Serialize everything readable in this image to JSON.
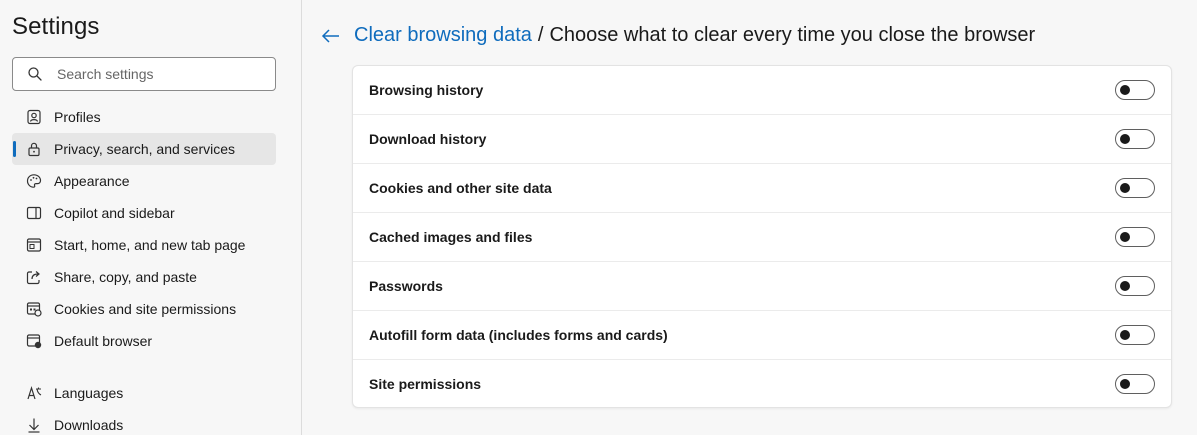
{
  "sidebar": {
    "title": "Settings",
    "search_placeholder": "Search settings",
    "items": [
      {
        "label": "Profiles",
        "icon": "profile-icon"
      },
      {
        "label": "Privacy, search, and services",
        "icon": "lock-icon",
        "active": true
      },
      {
        "label": "Appearance",
        "icon": "palette-icon"
      },
      {
        "label": "Copilot and sidebar",
        "icon": "sidebar-icon"
      },
      {
        "label": "Start, home, and new tab page",
        "icon": "home-icon"
      },
      {
        "label": "Share, copy, and paste",
        "icon": "share-icon"
      },
      {
        "label": "Cookies and site permissions",
        "icon": "cookies-icon"
      },
      {
        "label": "Default browser",
        "icon": "browser-icon"
      },
      {
        "label": "Languages",
        "icon": "languages-icon"
      },
      {
        "label": "Downloads",
        "icon": "download-icon"
      }
    ]
  },
  "header": {
    "back_icon": "back-arrow-icon",
    "link": "Clear browsing data",
    "separator": "/",
    "current": "Choose what to clear every time you close the browser"
  },
  "options": [
    {
      "label": "Browsing history",
      "enabled": false
    },
    {
      "label": "Download history",
      "enabled": false
    },
    {
      "label": "Cookies and other site data",
      "enabled": false
    },
    {
      "label": "Cached images and files",
      "enabled": false
    },
    {
      "label": "Passwords",
      "enabled": false
    },
    {
      "label": "Autofill form data (includes forms and cards)",
      "enabled": false
    },
    {
      "label": "Site permissions",
      "enabled": false
    }
  ],
  "colors": {
    "accent": "#0f6cbd",
    "background": "#f7f7f7",
    "card": "#ffffff"
  }
}
